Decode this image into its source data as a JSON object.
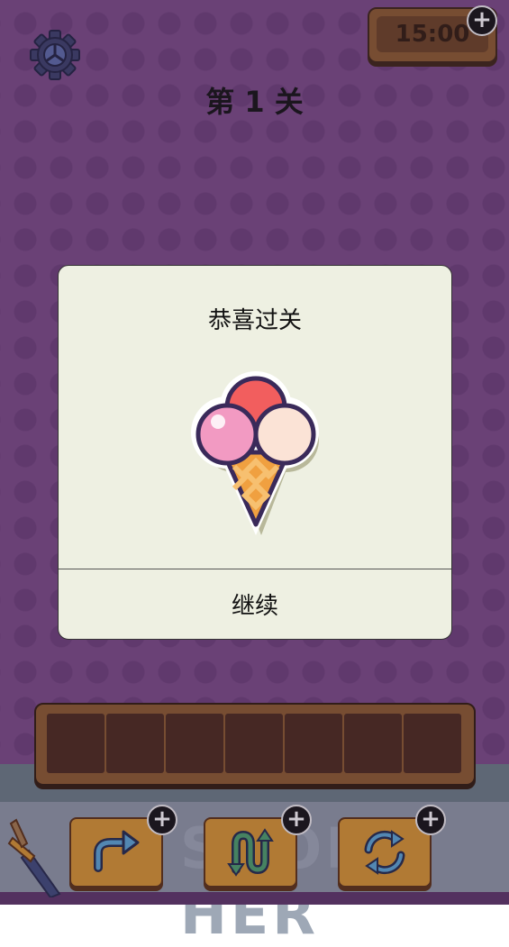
{
  "hud": {
    "timer": "15:00",
    "level_title": "第 1 关"
  },
  "modal": {
    "title": "恭喜过关",
    "continue_label": "继续",
    "reward_icon": "ice-cream-icon"
  },
  "slots": {
    "count": 7
  },
  "tools": [
    {
      "name": "undo",
      "icon": "undo-arrow-icon"
    },
    {
      "name": "swap",
      "icon": "swap-arrows-icon"
    },
    {
      "name": "shuffle",
      "icon": "refresh-icon"
    }
  ],
  "background_text": "SHOP HER",
  "colors": {
    "background": "#7a4a86",
    "modal": "#eef0e2",
    "wood": "#8b5a2b",
    "tool_button": "#d9962e"
  }
}
